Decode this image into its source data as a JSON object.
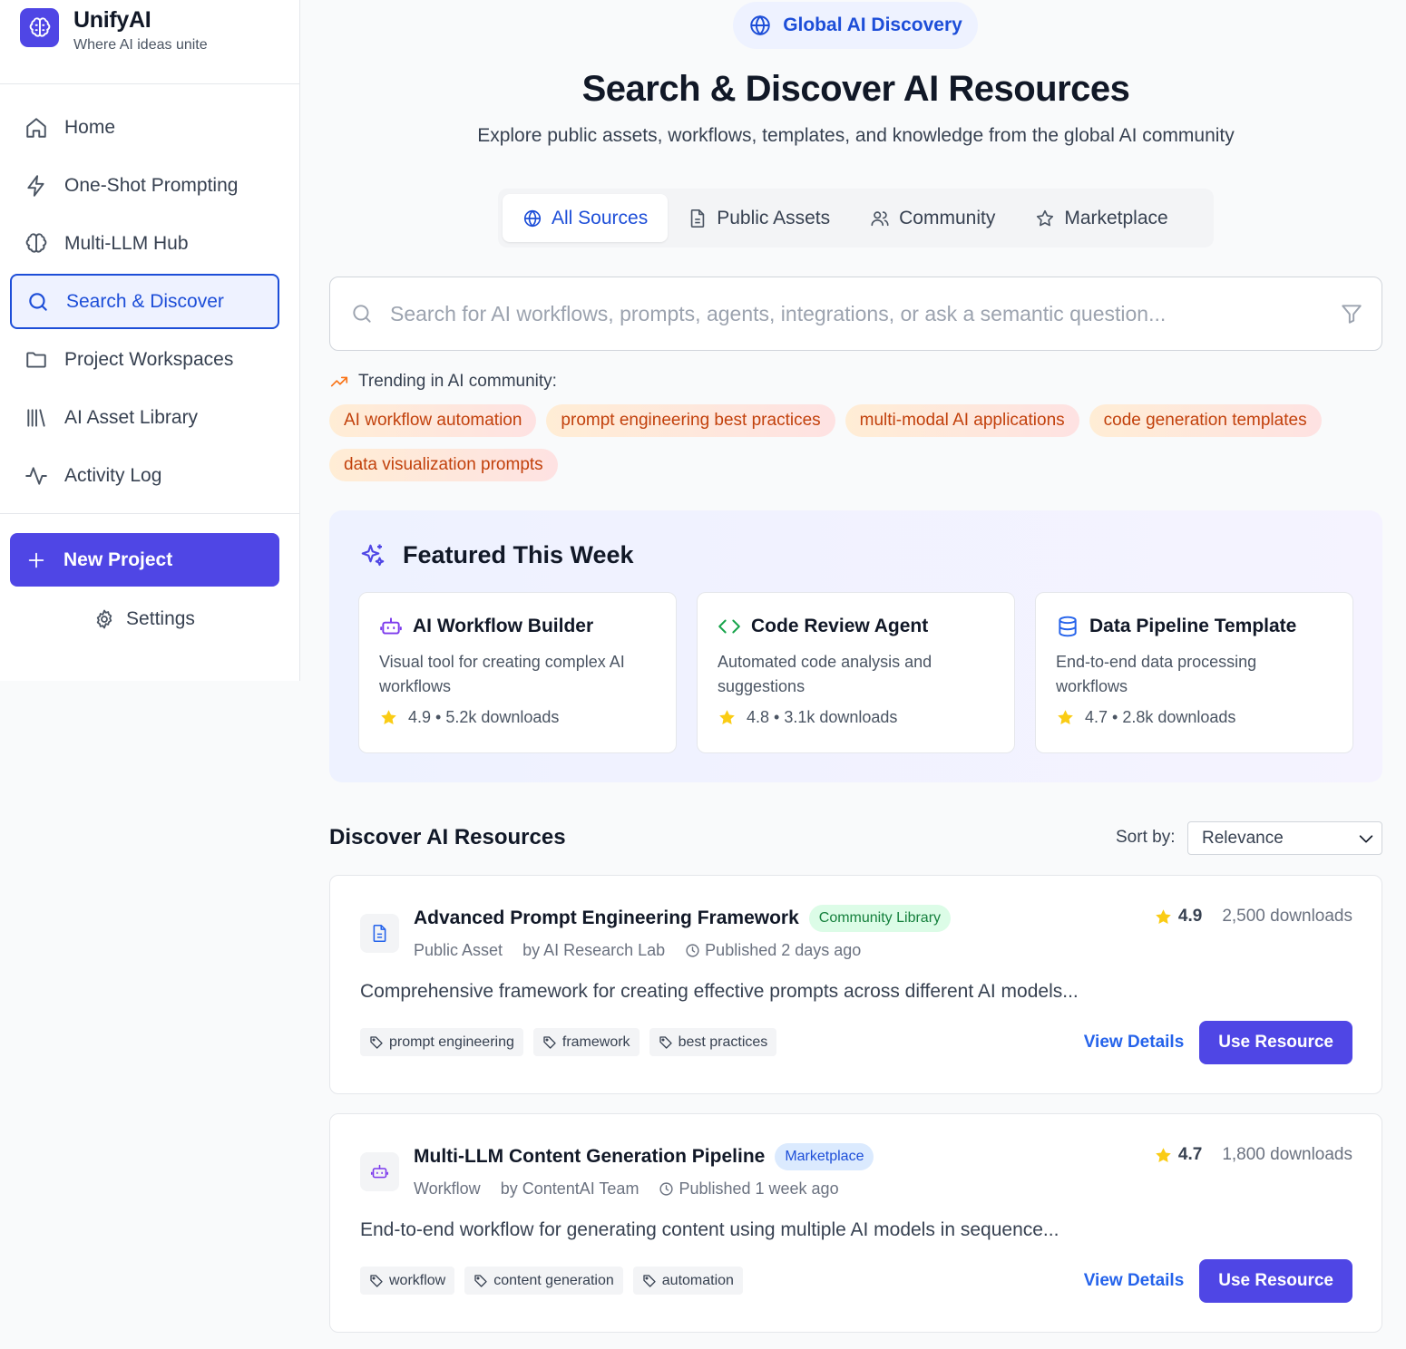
{
  "app": {
    "name": "UnifyAI",
    "tagline": "Where AI ideas unite"
  },
  "sidebar": {
    "items": [
      {
        "label": "Home",
        "icon": "home-icon"
      },
      {
        "label": "One-Shot Prompting",
        "icon": "lightning-icon"
      },
      {
        "label": "Multi-LLM Hub",
        "icon": "brain-icon"
      },
      {
        "label": "Search & Discover",
        "icon": "search-icon",
        "active": true
      },
      {
        "label": "Project Workspaces",
        "icon": "folder-icon"
      },
      {
        "label": "AI Asset Library",
        "icon": "library-icon"
      },
      {
        "label": "Activity Log",
        "icon": "activity-icon"
      }
    ],
    "new_project": "New Project",
    "settings": "Settings"
  },
  "header": {
    "badge": "Global AI Discovery",
    "title": "Search & Discover AI Resources",
    "subtitle": "Explore public assets, workflows, templates, and knowledge from the global AI community"
  },
  "tabs": [
    {
      "label": "All Sources",
      "icon": "globe-icon",
      "active": true
    },
    {
      "label": "Public Assets",
      "icon": "document-icon"
    },
    {
      "label": "Community",
      "icon": "users-icon"
    },
    {
      "label": "Marketplace",
      "icon": "star-outline-icon"
    }
  ],
  "search": {
    "value": "",
    "placeholder": "Search for AI workflows, prompts, agents, integrations, or ask a semantic question..."
  },
  "trending": {
    "label": "Trending in AI community:",
    "chips": [
      "AI workflow automation",
      "prompt engineering best practices",
      "multi-modal AI applications",
      "code generation templates",
      "data visualization prompts"
    ]
  },
  "featured": {
    "title": "Featured This Week",
    "cards": [
      {
        "title": "AI Workflow Builder",
        "desc": "Visual tool for creating complex AI workflows",
        "rating": "4.9",
        "downloads": "5.2k downloads",
        "icon": "robot-icon",
        "icon_color": "#7c3aed"
      },
      {
        "title": "Code Review Agent",
        "desc": "Automated code analysis and suggestions",
        "rating": "4.8",
        "downloads": "3.1k downloads",
        "icon": "code-icon",
        "icon_color": "#16a34a"
      },
      {
        "title": "Data Pipeline Template",
        "desc": "End-to-end data processing workflows",
        "rating": "4.7",
        "downloads": "2.8k downloads",
        "icon": "database-icon",
        "icon_color": "#2563eb"
      }
    ]
  },
  "discover": {
    "title": "Discover AI Resources",
    "sort_label": "Sort by:",
    "sort_value": "Relevance",
    "results": [
      {
        "title": "Advanced Prompt Engineering Framework",
        "badge": "Community Library",
        "type": "Public Asset",
        "author": "by AI Research Lab",
        "published": "Published 2 days ago",
        "rating": "4.9",
        "downloads": "2,500 downloads",
        "desc": "Comprehensive framework for creating effective prompts across different AI models...",
        "tags": [
          "prompt engineering",
          "framework",
          "best practices"
        ],
        "view": "View Details",
        "use": "Use Resource",
        "icon": "document-icon"
      },
      {
        "title": "Multi-LLM Content Generation Pipeline",
        "badge": "Marketplace",
        "type": "Workflow",
        "author": "by ContentAI Team",
        "published": "Published 1 week ago",
        "rating": "4.7",
        "downloads": "1,800 downloads",
        "desc": "End-to-end workflow for generating content using multiple AI models in sequence...",
        "tags": [
          "workflow",
          "content generation",
          "automation"
        ],
        "view": "View Details",
        "use": "Use Resource",
        "icon": "robot-icon"
      }
    ]
  },
  "colors": {
    "primary": "#4f46e5",
    "active_text": "#1d4ed8",
    "star": "#facc15",
    "trend_text": "#c2410c"
  }
}
